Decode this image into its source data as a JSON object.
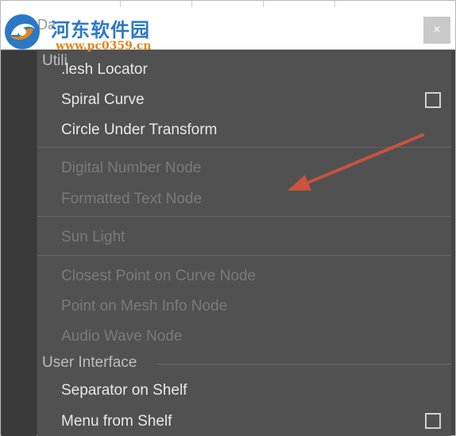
{
  "window": {
    "menu_label": "Da",
    "close_glyph": "×"
  },
  "watermark": {
    "site_name_cn": "河东软件园",
    "site_url": "www.pc0359.cn"
  },
  "menu": {
    "section_utilities": "Utili",
    "items_a": [
      {
        "label": ".lesh Locator",
        "enabled": true
      },
      {
        "label": "Spiral Curve",
        "enabled": true,
        "has_option_box": true
      },
      {
        "label": "Circle Under Transform",
        "enabled": true
      }
    ],
    "items_b": [
      {
        "label": "Digital Number Node",
        "enabled": false
      },
      {
        "label": "Formatted Text Node",
        "enabled": false
      }
    ],
    "items_c": [
      {
        "label": "Sun Light",
        "enabled": false
      }
    ],
    "items_d": [
      {
        "label": "Closest Point on Curve Node",
        "enabled": false
      },
      {
        "label": "Point on Mesh Info Node",
        "enabled": false
      },
      {
        "label": "Audio Wave Node",
        "enabled": false
      }
    ],
    "section_user_interface": "User Interface",
    "items_e": [
      {
        "label": "Separator on Shelf",
        "enabled": true
      },
      {
        "label": "Menu from Shelf",
        "enabled": true,
        "has_option_box": true
      }
    ]
  },
  "colors": {
    "menu_bg": "#515151",
    "enabled_text": "#e8e8e8",
    "disabled_text": "#7a7a7a",
    "annotation_arrow": "#c8533f",
    "watermark_blue": "#2b78c6",
    "watermark_orange": "#e0871b"
  },
  "icons": {
    "close": "close-icon",
    "watermark_logo": "swirl-logo-icon",
    "option_box": "checkbox-icon",
    "annotation": "arrow-annotation"
  }
}
